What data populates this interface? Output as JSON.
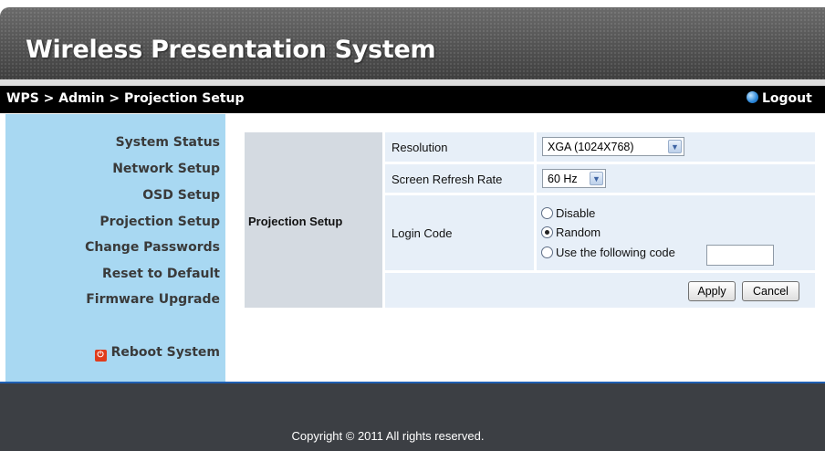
{
  "header": {
    "title": "Wireless Presentation System"
  },
  "breadcrumb": "WPS > Admin > Projection Setup",
  "logout_label": "Logout",
  "sidebar": {
    "items": [
      {
        "label": "System Status"
      },
      {
        "label": "Network Setup"
      },
      {
        "label": "OSD Setup"
      },
      {
        "label": "Projection Setup"
      },
      {
        "label": "Change Passwords"
      },
      {
        "label": "Reset to Default"
      },
      {
        "label": "Firmware Upgrade"
      }
    ],
    "reboot_label": "Reboot System"
  },
  "form": {
    "section_label": "Projection Setup",
    "resolution": {
      "label": "Resolution",
      "value": "XGA (1024X768)"
    },
    "refresh_rate": {
      "label": "Screen Refresh Rate",
      "value": "60 Hz"
    },
    "login_code": {
      "label": "Login Code",
      "options": [
        "Disable",
        "Random",
        "Use the following code"
      ],
      "selected": "Random",
      "code_value": ""
    },
    "apply_label": "Apply",
    "cancel_label": "Cancel"
  },
  "footer": {
    "copyright": "Copyright © 2011 All rights reserved."
  },
  "colors": {
    "sidebar_bg": "#a8d8f2",
    "crumb_bar": "#000000",
    "form_cell": "#e7eff8",
    "section_cell": "#d4dae1",
    "footer_bg": "#3c3f44",
    "reboot_icon": "#e03c1c"
  }
}
